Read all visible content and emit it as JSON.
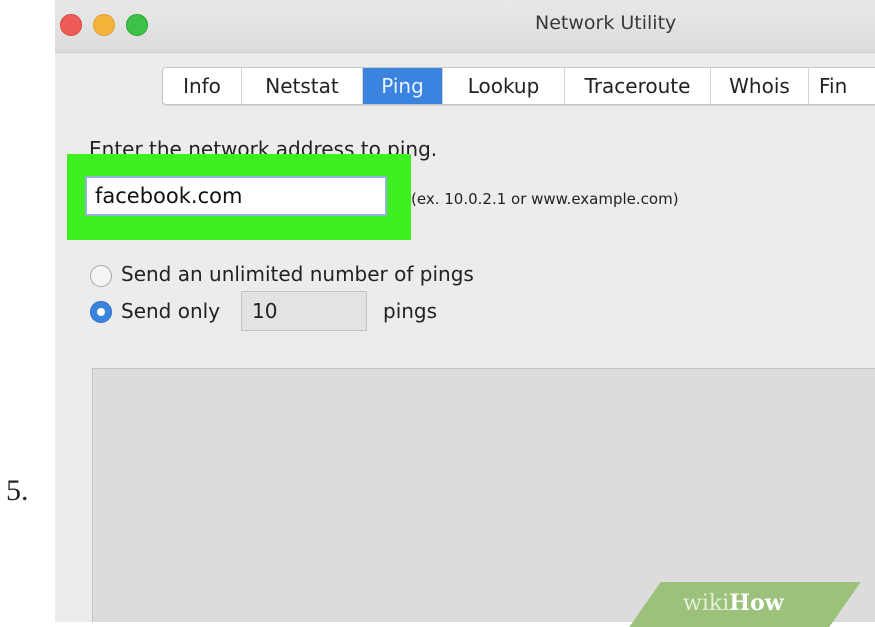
{
  "step": {
    "number": "5."
  },
  "window": {
    "title": "Network Utility",
    "traffic_lights": {
      "close": "#ef5b56",
      "minimize": "#f4b53a",
      "zoom": "#3cc248"
    }
  },
  "tabs": [
    {
      "label": "Info",
      "active": false
    },
    {
      "label": "Netstat",
      "active": false
    },
    {
      "label": "Ping",
      "active": true
    },
    {
      "label": "Lookup",
      "active": false
    },
    {
      "label": "Traceroute",
      "active": false
    },
    {
      "label": "Whois",
      "active": false
    },
    {
      "label": "Fin",
      "active": false
    }
  ],
  "ping": {
    "prompt": "Enter the network address to ping.",
    "address_value": "facebook.com",
    "example_hint": "(ex. 10.0.2.1 or www.example.com)",
    "option_unlimited": "Send an unlimited number of pings",
    "option_only": "Send only",
    "count_value": "10",
    "count_suffix": "pings",
    "selected_option": "only"
  },
  "watermark": {
    "part1": "wiki",
    "part2": "How"
  },
  "colors": {
    "highlight": "#3ff01f",
    "accent": "#3a84e0",
    "watermark": "#9bc17a"
  }
}
